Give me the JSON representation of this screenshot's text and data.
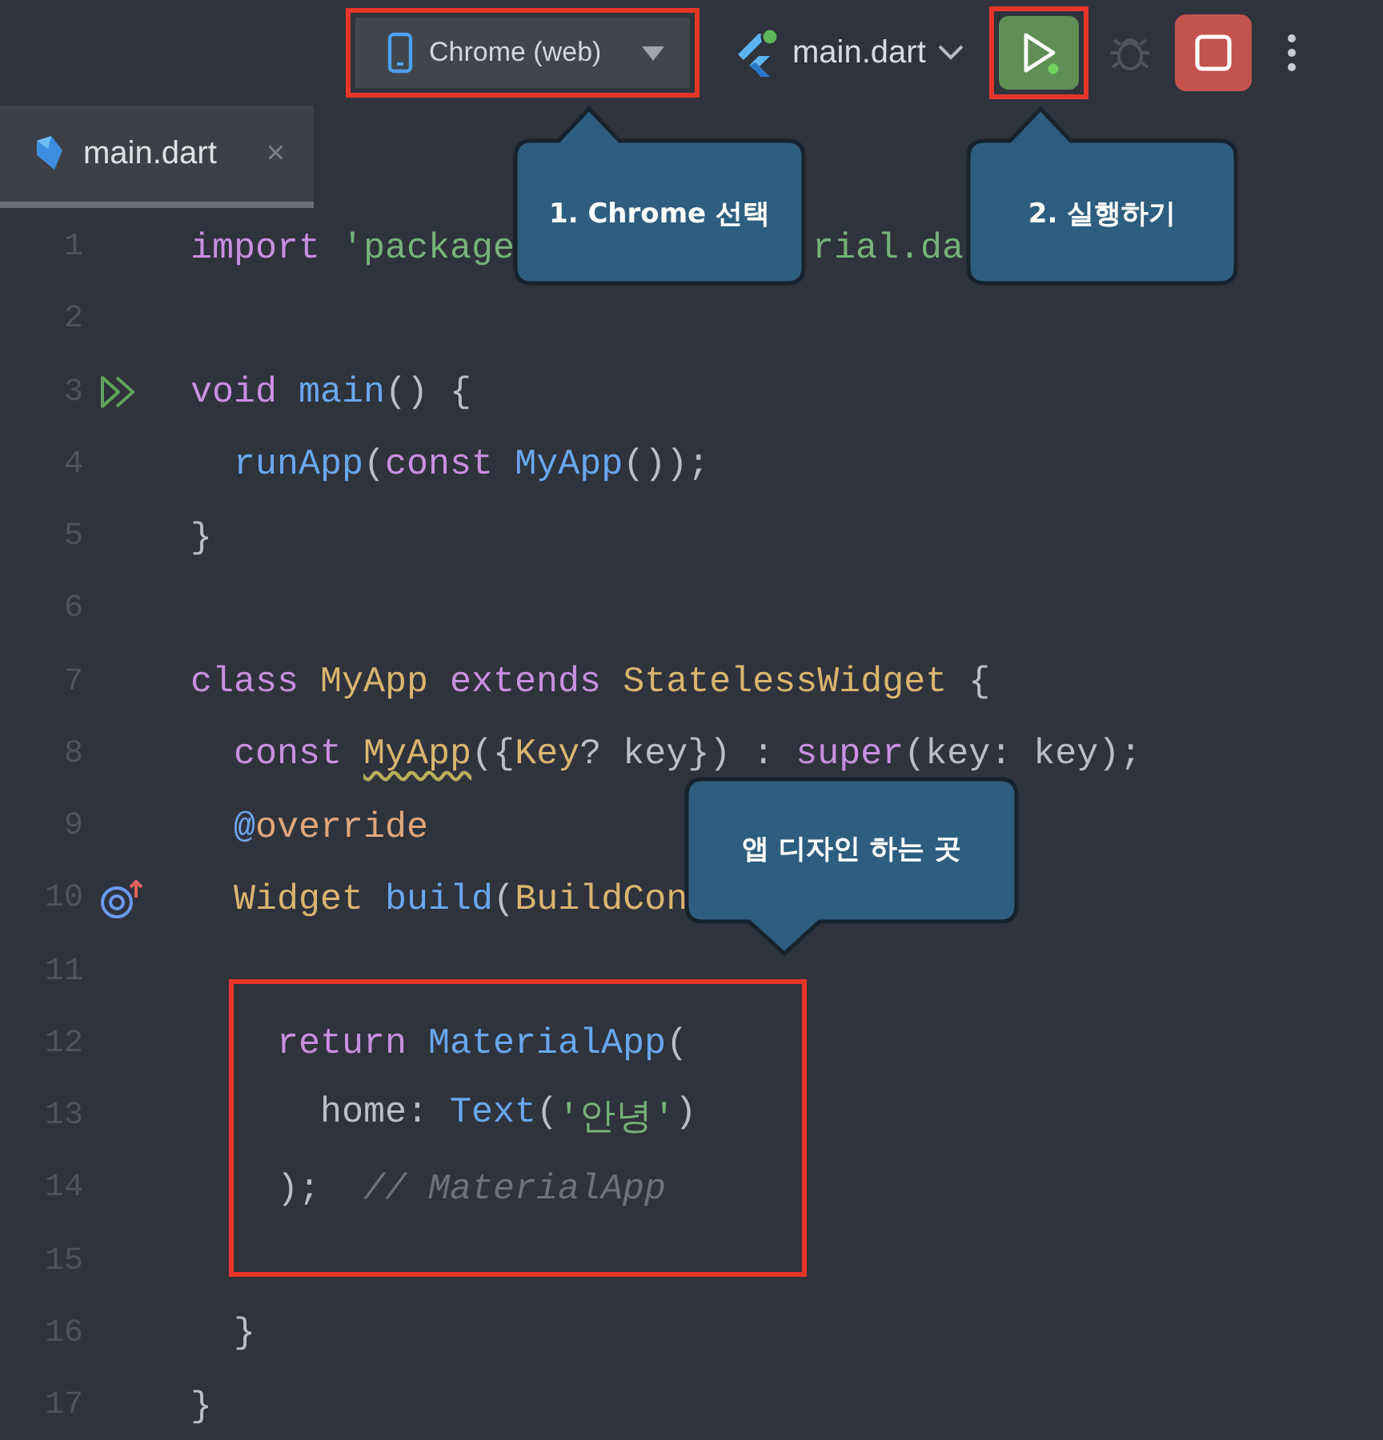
{
  "toolbar": {
    "device_selector": {
      "label": "Chrome (web)",
      "highlighted": true
    },
    "run_config": {
      "label": "main.dart"
    },
    "run_button": {
      "highlighted": true,
      "disabled": false
    },
    "debug_button": {
      "disabled": true
    },
    "stop_button": {
      "disabled": false
    }
  },
  "tabs": [
    {
      "label": "main.dart",
      "selected": true,
      "close_glyph": "×"
    }
  ],
  "code_lines": [
    {
      "number": "1",
      "tokens": [
        {
          "kind": "keyword",
          "text": "import "
        },
        {
          "kind": "string",
          "text": "'package"
        },
        {
          "kind": "string",
          "text": "rial.da",
          "covered_before": true
        }
      ]
    },
    {
      "number": "2"
    },
    {
      "number": "3",
      "kind": "run",
      "tokens": [
        {
          "kind": "keyword",
          "text": "void "
        },
        {
          "kind": "function",
          "text": "main"
        },
        {
          "kind": "plain",
          "text": "() {"
        }
      ]
    },
    {
      "number": "4",
      "tokens": [
        {
          "kind": "function",
          "text": "  runApp"
        },
        {
          "kind": "plain",
          "text": "("
        },
        {
          "kind": "keyword",
          "text": "const "
        },
        {
          "kind": "function",
          "text": "MyApp"
        },
        {
          "kind": "plain",
          "text": "());"
        }
      ]
    },
    {
      "number": "5",
      "tokens": [
        {
          "kind": "plain",
          "text": "}"
        }
      ]
    },
    {
      "number": "6"
    },
    {
      "number": "7",
      "tokens": [
        {
          "kind": "keyword",
          "text": "class "
        },
        {
          "kind": "type",
          "text": "MyApp "
        },
        {
          "kind": "keyword",
          "text": "extends "
        },
        {
          "kind": "type",
          "text": "StatelessWidget"
        },
        {
          "kind": "plain",
          "text": " {"
        }
      ]
    },
    {
      "number": "8",
      "tokens": [
        {
          "kind": "keyword",
          "text": "  const "
        },
        {
          "kind": "type",
          "text": "MyApp",
          "warning": true
        },
        {
          "kind": "plain",
          "text": "({"
        },
        {
          "kind": "type",
          "text": "Key"
        },
        {
          "kind": "plain",
          "text": "? key}) : "
        },
        {
          "kind": "keyword",
          "text": "super"
        },
        {
          "kind": "plain",
          "text": "(key: key);"
        }
      ]
    },
    {
      "number": "9",
      "tokens": [
        {
          "kind": "annotation",
          "text": "  @"
        },
        {
          "kind": "annotation_name",
          "text": "override"
        }
      ]
    },
    {
      "number": "10",
      "kind": "override",
      "tokens": [
        {
          "kind": "type",
          "text": "  Widget "
        },
        {
          "kind": "function",
          "text": "build"
        },
        {
          "kind": "plain",
          "text": "("
        },
        {
          "kind": "type",
          "text": "BuildCon"
        }
      ]
    },
    {
      "number": "11"
    },
    {
      "number": "12",
      "tokens": [
        {
          "kind": "keyword",
          "text": "    return "
        },
        {
          "kind": "function",
          "text": "MaterialApp"
        },
        {
          "kind": "plain",
          "text": "("
        }
      ]
    },
    {
      "number": "13",
      "tokens": [
        {
          "kind": "plain",
          "text": "      home: "
        },
        {
          "kind": "function",
          "text": "Text"
        },
        {
          "kind": "plain",
          "text": "("
        },
        {
          "kind": "string",
          "text": "'안녕'"
        },
        {
          "kind": "plain",
          "text": ")"
        }
      ]
    },
    {
      "number": "14",
      "tokens": [
        {
          "kind": "plain",
          "text": "    );  "
        },
        {
          "kind": "comment",
          "text": "// MaterialApp"
        }
      ]
    },
    {
      "number": "15"
    },
    {
      "number": "16",
      "tokens": [
        {
          "kind": "plain",
          "text": "  }"
        }
      ]
    },
    {
      "number": "17",
      "tokens": [
        {
          "kind": "plain",
          "text": "}"
        }
      ]
    }
  ],
  "callouts": [
    {
      "text": "1. Chrome 선택"
    },
    {
      "text": "2. 실행하기"
    },
    {
      "text": "앱 디자인 하는 곳"
    }
  ]
}
